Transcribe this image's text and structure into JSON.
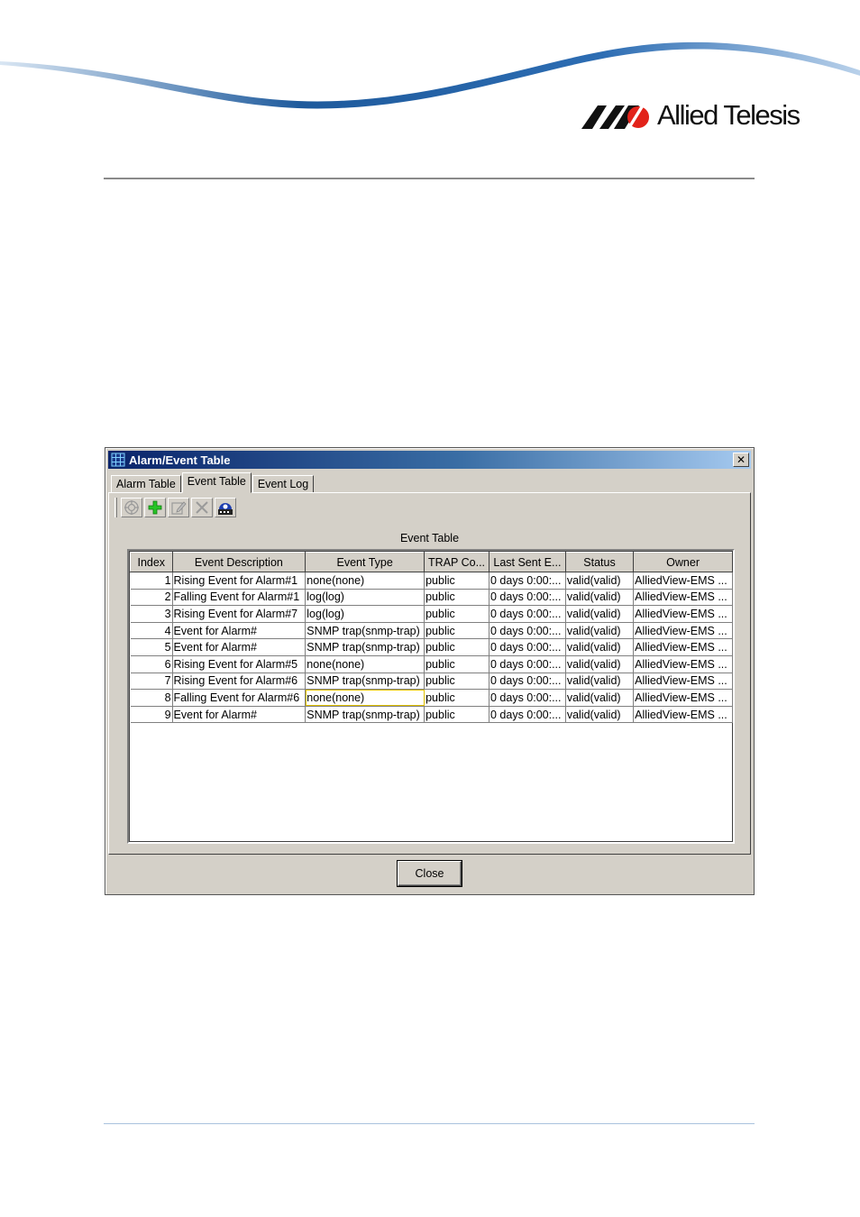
{
  "brand": {
    "logo_text": "Allied Telesis"
  },
  "window": {
    "title": "Alarm/Event Table",
    "close_glyph": "✕"
  },
  "tabs": [
    {
      "label": "Alarm Table",
      "active": false
    },
    {
      "label": "Event Table",
      "active": true
    },
    {
      "label": "Event Log",
      "active": false
    }
  ],
  "toolbar": {
    "buttons": [
      {
        "icon": "target-icon",
        "enabled": false
      },
      {
        "icon": "add-icon",
        "enabled": true
      },
      {
        "icon": "edit-icon",
        "enabled": false
      },
      {
        "icon": "delete-icon",
        "enabled": false
      },
      {
        "icon": "refresh-device-icon",
        "enabled": true
      }
    ]
  },
  "table": {
    "caption": "Event Table",
    "columns": [
      "Index",
      "Event Description",
      "Event Type",
      "TRAP Co...",
      "Last Sent E...",
      "Status",
      "Owner"
    ],
    "rows": [
      [
        "1",
        "Rising Event for Alarm#1",
        "none(none)",
        "public",
        "0 days 0:00:...",
        "valid(valid)",
        "AlliedView-EMS ..."
      ],
      [
        "2",
        "Falling Event for Alarm#1",
        "log(log)",
        "public",
        "0 days 0:00:...",
        "valid(valid)",
        "AlliedView-EMS ..."
      ],
      [
        "3",
        "Rising Event for Alarm#7",
        "log(log)",
        "public",
        "0 days 0:00:...",
        "valid(valid)",
        "AlliedView-EMS ..."
      ],
      [
        "4",
        "Event for Alarm#",
        "SNMP trap(snmp-trap)",
        "public",
        "0 days 0:00:...",
        "valid(valid)",
        "AlliedView-EMS ..."
      ],
      [
        "5",
        "Event for Alarm#",
        "SNMP trap(snmp-trap)",
        "public",
        "0 days 0:00:...",
        "valid(valid)",
        "AlliedView-EMS ..."
      ],
      [
        "6",
        "Rising Event for Alarm#5",
        "none(none)",
        "public",
        "0 days 0:00:...",
        "valid(valid)",
        "AlliedView-EMS ..."
      ],
      [
        "7",
        "Rising Event for Alarm#6",
        "SNMP trap(snmp-trap)",
        "public",
        "0 days 0:00:...",
        "valid(valid)",
        "AlliedView-EMS ..."
      ],
      [
        "8",
        "Falling Event for Alarm#6",
        "none(none)",
        "public",
        "0 days 0:00:...",
        "valid(valid)",
        "AlliedView-EMS ..."
      ],
      [
        "9",
        "Event for Alarm#",
        "SNMP trap(snmp-trap)",
        "public",
        "0 days 0:00:...",
        "valid(valid)",
        "AlliedView-EMS ..."
      ]
    ],
    "focused_cell": {
      "row": 7,
      "col": 2
    }
  },
  "footer": {
    "close_label": "Close"
  },
  "colors": {
    "brand_red": "#e2231a",
    "swoosh_blue": "#1e5a9c",
    "title_gradient_start": "#0a246a",
    "dialog_bg": "#d4d0c8"
  }
}
